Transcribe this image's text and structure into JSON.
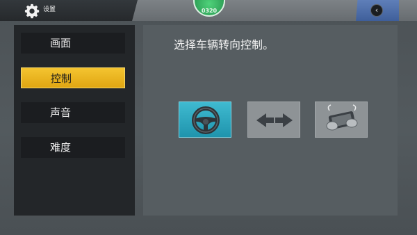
{
  "header": {
    "title": "设置",
    "title_icon": "gear-icon",
    "currency_label": "0320",
    "back_icon": "chevron-left-icon"
  },
  "sidebar": {
    "items": [
      {
        "label": "画面",
        "active": false
      },
      {
        "label": "控制",
        "active": true
      },
      {
        "label": "声音",
        "active": false
      },
      {
        "label": "难度",
        "active": false
      }
    ]
  },
  "main": {
    "prompt": "选择车辆转向控制。",
    "options": [
      {
        "icon": "steering-wheel-icon",
        "selected": true
      },
      {
        "icon": "left-right-arrows-icon",
        "selected": false
      },
      {
        "icon": "tilt-device-icon",
        "selected": false
      }
    ]
  },
  "colors": {
    "accent_yellow": "#f4c430",
    "selected_cyan": "#2aa8c0",
    "back_blue": "#4f6fab",
    "currency_green": "#3cbf68"
  }
}
